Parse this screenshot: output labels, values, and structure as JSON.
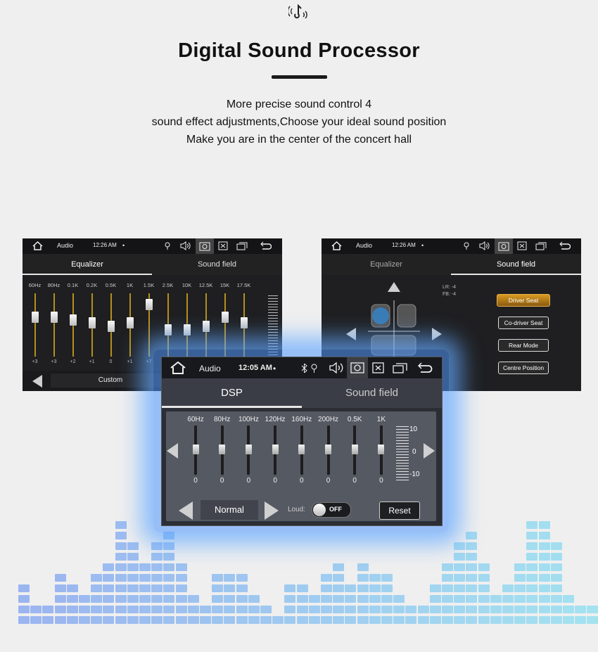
{
  "header": {
    "title": "Digital Sound Processor",
    "subtitle_lines": [
      "More precise sound control 4",
      "sound effect adjustments,Choose your ideal sound position",
      "Make you are in the center of the concert hall"
    ]
  },
  "left_screen": {
    "status": {
      "app": "Audio",
      "time": "12:26 AM",
      "dot": "•"
    },
    "tabs": [
      {
        "label": "Equalizer",
        "active": true
      },
      {
        "label": "Sound field",
        "active": false
      }
    ],
    "bands": [
      {
        "freq": "60Hz",
        "value": "+3"
      },
      {
        "freq": "80Hz",
        "value": "+3"
      },
      {
        "freq": "0.1K",
        "value": "+2"
      },
      {
        "freq": "0.2K",
        "value": "+1"
      },
      {
        "freq": "0.5K",
        "value": "0"
      },
      {
        "freq": "1K",
        "value": "+1"
      },
      {
        "freq": "1.5K",
        "value": "+7"
      },
      {
        "freq": "2.5K",
        "value": ""
      },
      {
        "freq": "10K",
        "value": ""
      },
      {
        "freq": "12.5K",
        "value": ""
      },
      {
        "freq": "15K",
        "value": ""
      },
      {
        "freq": "17.5K",
        "value": ""
      }
    ],
    "preset": "Custom"
  },
  "right_screen": {
    "status": {
      "app": "Audio",
      "time": "12:26 AM",
      "dot": "•"
    },
    "tabs": [
      {
        "label": "Equalizer",
        "active": false
      },
      {
        "label": "Sound field",
        "active": true
      }
    ],
    "readout": {
      "lr": "LR: -4",
      "fb": "FB: -4"
    },
    "buttons": [
      "Driver Seat",
      "Co-driver Seat",
      "Rear Mode",
      "Centre Position"
    ]
  },
  "dsp_screen": {
    "status": {
      "app": "Audio",
      "time": "12:05 AM",
      "dot": "•"
    },
    "tabs": [
      {
        "label": "DSP",
        "active": true
      },
      {
        "label": "Sound field",
        "active": false
      }
    ],
    "bands": [
      {
        "freq": "60Hz",
        "value": "0"
      },
      {
        "freq": "80Hz",
        "value": "0"
      },
      {
        "freq": "100Hz",
        "value": "0"
      },
      {
        "freq": "120Hz",
        "value": "0"
      },
      {
        "freq": "160Hz",
        "value": "0"
      },
      {
        "freq": "200Hz",
        "value": "0"
      },
      {
        "freq": "0.5K",
        "value": "0"
      },
      {
        "freq": "1K",
        "value": "0"
      }
    ],
    "scale": {
      "top": "10",
      "mid": "0",
      "bottom": "-10"
    },
    "preset": "Normal",
    "loud_label": "Loud:",
    "loud_state": "OFF",
    "reset_label": "Reset"
  },
  "colors": {
    "accent": "#b68f1e",
    "glow": "#6fb0ff",
    "bars": "#a9cdf7"
  }
}
